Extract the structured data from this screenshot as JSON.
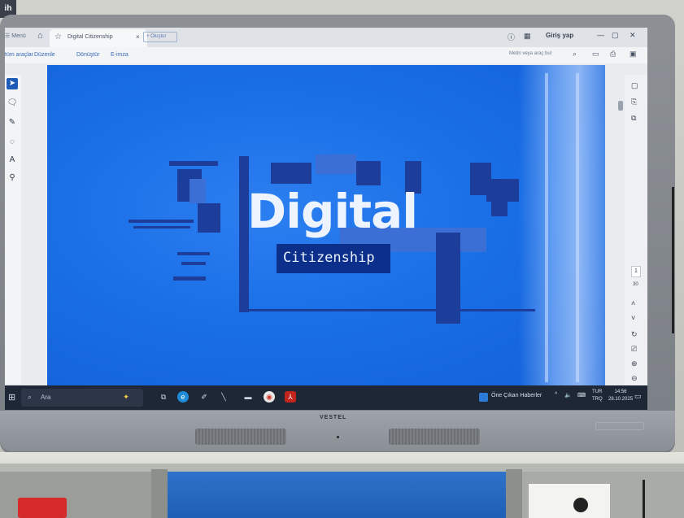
{
  "top_badge": "ih",
  "browser": {
    "menu_label": "Menü",
    "active_tab_title": "Digital Citizenship",
    "new_tab_label": "+ Oluştur",
    "sign_in": "Giriş yap",
    "toolbar": [
      "tüm araçlar",
      "Düzenle",
      "Dönüştür",
      "E-imza"
    ],
    "search_placeholder": "Metin veya araç bul"
  },
  "slide": {
    "title": "Digital",
    "subtitle": "Citizenship"
  },
  "page_indicator": {
    "current": "1",
    "total": "30"
  },
  "taskbar": {
    "search_placeholder": "Ara",
    "news": "Öne Çıkan Haberler",
    "lang_line1": "TUR",
    "lang_line2": "TRQ",
    "time": "14:56",
    "date": "28.10.2025"
  },
  "bezel": {
    "brand": "VESTEL"
  },
  "colors": {
    "slide_bg": "#1a6fe6",
    "subtitle_box": "#0b2f8a",
    "accent": "#1e5bb8",
    "taskbar": "#1d2735"
  }
}
